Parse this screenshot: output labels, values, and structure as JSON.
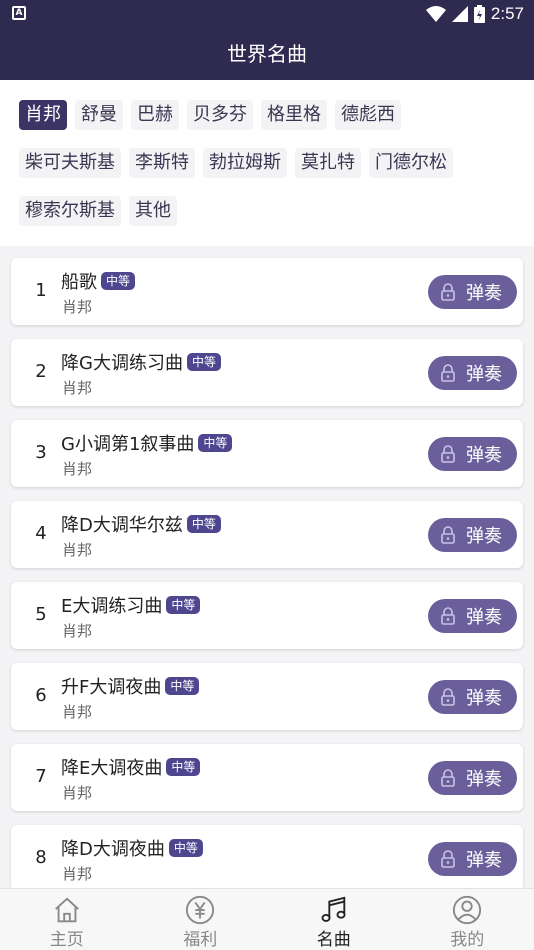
{
  "status_bar": {
    "time": "2:57",
    "left_icon_text": "A"
  },
  "header": {
    "title": "世界名曲"
  },
  "composer_tags": {
    "rows": [
      [
        {
          "label": "肖邦",
          "active": true
        },
        {
          "label": "舒曼"
        },
        {
          "label": "巴赫"
        },
        {
          "label": "贝多芬"
        },
        {
          "label": "格里格"
        },
        {
          "label": "德彪西"
        }
      ],
      [
        {
          "label": "柴可夫斯基"
        },
        {
          "label": "李斯特"
        },
        {
          "label": "勃拉姆斯"
        },
        {
          "label": "莫扎特"
        },
        {
          "label": "门德尔松"
        }
      ],
      [
        {
          "label": "穆索尔斯基"
        },
        {
          "label": "其他"
        }
      ]
    ]
  },
  "songs": [
    {
      "num": "1",
      "name": "船歌",
      "level": "中等",
      "composer": "肖邦",
      "action": "弹奏"
    },
    {
      "num": "2",
      "name": "降G大调练习曲",
      "level": "中等",
      "composer": "肖邦",
      "action": "弹奏"
    },
    {
      "num": "3",
      "name": "G小调第1叙事曲",
      "level": "中等",
      "composer": "肖邦",
      "action": "弹奏"
    },
    {
      "num": "4",
      "name": "降D大调华尔兹",
      "level": "中等",
      "composer": "肖邦",
      "action": "弹奏"
    },
    {
      "num": "5",
      "name": "E大调练习曲",
      "level": "中等",
      "composer": "肖邦",
      "action": "弹奏"
    },
    {
      "num": "6",
      "name": "升F大调夜曲",
      "level": "中等",
      "composer": "肖邦",
      "action": "弹奏"
    },
    {
      "num": "7",
      "name": "降E大调夜曲",
      "level": "中等",
      "composer": "肖邦",
      "action": "弹奏"
    },
    {
      "num": "8",
      "name": "降D大调夜曲",
      "level": "中等",
      "composer": "肖邦",
      "action": "弹奏"
    }
  ],
  "tab_bar": {
    "tabs": [
      {
        "label": "主页",
        "icon": "home-icon"
      },
      {
        "label": "福利",
        "icon": "yen-icon"
      },
      {
        "label": "名曲",
        "icon": "music-note-icon",
        "active": true
      },
      {
        "label": "我的",
        "icon": "user-icon"
      }
    ]
  },
  "colors": {
    "header_bg": "#2f2a4f",
    "active_tag": "#3d3466",
    "badge": "#4f4690",
    "play_button": "#6a5f9a"
  }
}
